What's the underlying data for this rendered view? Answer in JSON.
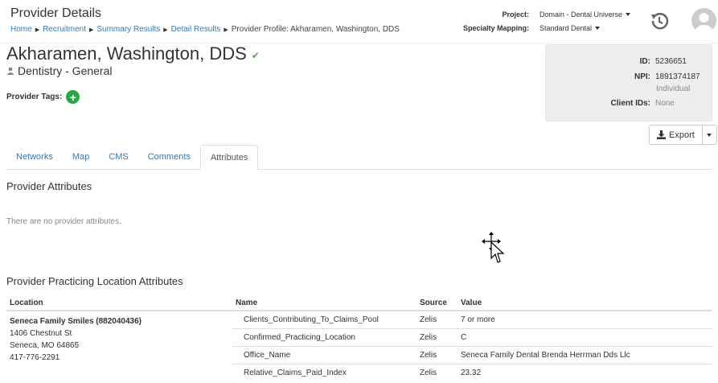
{
  "header": {
    "title": "Provider Details",
    "breadcrumb": [
      "Home",
      "Recruitment",
      "Summary Results",
      "Detail Results",
      "Provider Profile: Akharamen, Washington, DDS"
    ],
    "project_label": "Project:",
    "project_value": "Domain - Dental Universe",
    "specialty_mapping_label": "Specialty Mapping:",
    "specialty_mapping_value": "Standard Dental"
  },
  "provider": {
    "name": "Akharamen, Washington, DDS",
    "specialty": "Dentistry - General",
    "tags_label": "Provider Tags:",
    "add_tag": "+"
  },
  "ids": {
    "id_label": "ID:",
    "id_value": "5236651",
    "npi_label": "NPI:",
    "npi_value": "1891374187",
    "npi_type": "Individual",
    "client_ids_label": "Client IDs:",
    "client_ids_value": "None"
  },
  "export": {
    "label": "Export"
  },
  "tabs": [
    {
      "label": "Networks",
      "active": false
    },
    {
      "label": "Map",
      "active": false
    },
    {
      "label": "CMS",
      "active": false
    },
    {
      "label": "Comments",
      "active": false
    },
    {
      "label": "Attributes",
      "active": true
    }
  ],
  "provider_attributes": {
    "title": "Provider Attributes",
    "empty_text": "There are no provider attributes."
  },
  "location_attributes": {
    "title": "Provider Practicing Location Attributes",
    "columns": [
      "Location",
      "Name",
      "Source",
      "Value"
    ],
    "location": {
      "name": "Seneca Family Smiles (882040436)",
      "address1": "1406 Chestnut St",
      "address2": "Seneca, MO 64865",
      "phone": "417-776-2291"
    },
    "rows": [
      {
        "name": "Clients_Contributing_To_Claims_Pool",
        "source": "Zelis",
        "value": "7 or more"
      },
      {
        "name": "Confirmed_Practicing_Location",
        "source": "Zelis",
        "value": "C"
      },
      {
        "name": "Office_Name",
        "source": "Zelis",
        "value": "Seneca Family Dental Brenda Herrman Dds Llc"
      },
      {
        "name": "Relative_Claims_Paid_Index",
        "source": "Zelis",
        "value": "23.32"
      }
    ]
  },
  "colors": {
    "link": "#337ab7",
    "success": "#28a745",
    "panel": "#eeeeee"
  }
}
